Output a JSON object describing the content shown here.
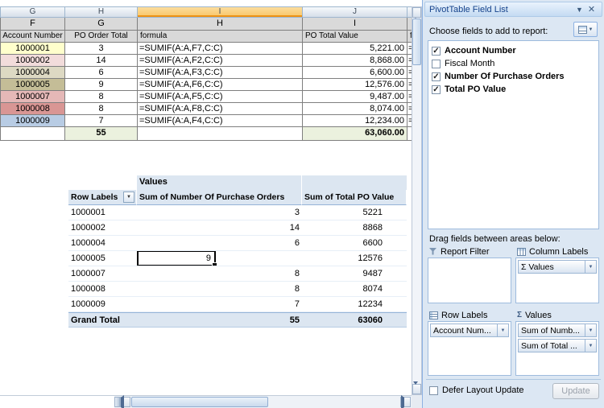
{
  "colors": {
    "selected_column_header": "#F8C566",
    "pivot_band": "#DCE6F1",
    "grid_header_fill": "#D9D9D9",
    "totals_fill": "#EBF1DE",
    "panel_bg": "#DCE7F3",
    "selection_border": "#000000"
  },
  "sheet": {
    "col_letters_top": [
      "G",
      "H",
      "I",
      "J"
    ],
    "letter_cells": [
      "F",
      "G",
      "H",
      "I"
    ],
    "header_cells": [
      "Account Number",
      "PO Order Total",
      "formula",
      "PO Total Value"
    ],
    "clipped_header": "fo",
    "clipped_cell": "=",
    "rows": [
      {
        "account": "1000001",
        "orders": "3",
        "formula": "=SUMIF(A:A,F7,C:C)",
        "value": "5,221.00",
        "fill": "#FFFFCC"
      },
      {
        "account": "1000002",
        "orders": "14",
        "formula": "=SUMIF(A:A,F2,C:C)",
        "value": "8,868.00",
        "fill": "#F2DCDB"
      },
      {
        "account": "1000004",
        "orders": "6",
        "formula": "=SUMIF(A:A,F3,C:C)",
        "value": "6,600.00",
        "fill": "#DDD9C3"
      },
      {
        "account": "1000005",
        "orders": "9",
        "formula": "=SUMIF(A:A,F6,C:C)",
        "value": "12,576.00",
        "fill": "#C4BD97"
      },
      {
        "account": "1000007",
        "orders": "8",
        "formula": "=SUMIF(A:A,F5,C:C)",
        "value": "9,487.00",
        "fill": "#E5B8B7"
      },
      {
        "account": "1000008",
        "orders": "8",
        "formula": "=SUMIF(A:A,F8,C:C)",
        "value": "8,074.00",
        "fill": "#D99694"
      },
      {
        "account": "1000009",
        "orders": "7",
        "formula": "=SUMIF(A:A,F4,C:C)",
        "value": "12,234.00",
        "fill": "#B8CCE4"
      }
    ],
    "totals": {
      "orders": "55",
      "value": "63,060.00"
    }
  },
  "pivot": {
    "values_label": "Values",
    "headers": [
      "Row Labels",
      "Sum of Number Of Purchase Orders",
      "Sum of Total PO Value"
    ],
    "rows": [
      {
        "label": "1000001",
        "orders": "3",
        "value": "5221"
      },
      {
        "label": "1000002",
        "orders": "14",
        "value": "8868"
      },
      {
        "label": "1000004",
        "orders": "6",
        "value": "6600"
      },
      {
        "label": "1000005",
        "orders": "9",
        "value": "12576",
        "selected": true
      },
      {
        "label": "1000007",
        "orders": "8",
        "value": "9487"
      },
      {
        "label": "1000008",
        "orders": "8",
        "value": "8074"
      },
      {
        "label": "1000009",
        "orders": "7",
        "value": "12234"
      }
    ],
    "grand_total": {
      "label": "Grand Total",
      "orders": "55",
      "value": "63060"
    }
  },
  "panel": {
    "title": "PivotTable Field List",
    "choose_fields_label": "Choose fields to add to report:",
    "fields": [
      {
        "name": "Account Number",
        "checked": true,
        "check": "✓"
      },
      {
        "name": "Fiscal Month",
        "checked": false,
        "check": ""
      },
      {
        "name": "Number Of Purchase Orders",
        "checked": true,
        "check": "✓"
      },
      {
        "name": "Total PO Value",
        "checked": true,
        "check": "✓"
      }
    ],
    "drag_fields_label": "Drag fields between areas below:",
    "areas": {
      "report_filter_label": "Report Filter",
      "column_labels_label": "Column Labels",
      "row_labels_label": "Row Labels",
      "values_label": "Values",
      "column_labels_items": [
        "Σ Values"
      ],
      "row_labels_items": [
        "Account Num..."
      ],
      "values_items": [
        "Sum of Numb...",
        "Sum of Total ..."
      ]
    },
    "defer_layout_label": "Defer Layout Update",
    "update_button_label": "Update"
  }
}
